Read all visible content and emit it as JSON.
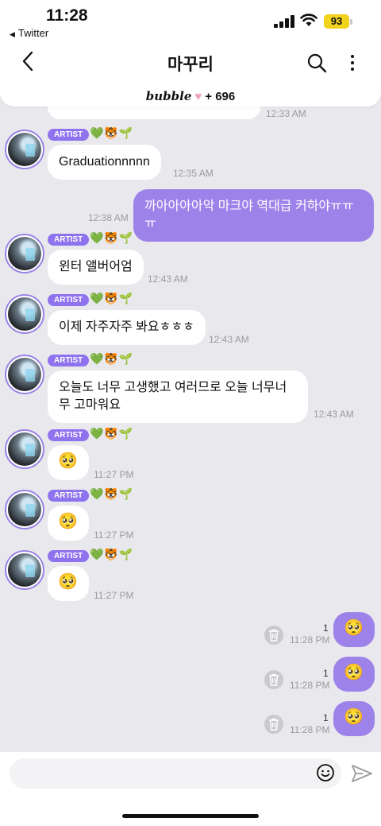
{
  "status_bar": {
    "time": "11:28",
    "back_app": "Twitter",
    "battery": "93"
  },
  "header": {
    "title": "마꾸리",
    "brand": "bubble",
    "count": "+ 696"
  },
  "artist_tag": "ARTIST",
  "emoji_icons": "💚🐯🌱",
  "messages": {
    "partial_time": "12:33 AM",
    "m1_text": "Graduationnnnn",
    "m1_time": "12:35 AM",
    "m2_text": "까아아아아악 마크야 역대급 커하야ㅠㅠㅠ",
    "m2_time": "12:38 AM",
    "m3_text": "윈터 앨버어엄",
    "m3_time": "12:43 AM",
    "m4_text": "이제 자주자주 봐요ㅎㅎㅎ",
    "m4_time": "12:43 AM",
    "m5_text": "오늘도 너무 고생했고 여러므로 오늘 너무너무 고마워요",
    "m5_time": "12:43 AM",
    "m6_text": "🥺",
    "m6_time": "11:27 PM",
    "m7_text": "🥺",
    "m7_time": "11:27 PM",
    "m8_text": "🥺",
    "m8_time": "11:27 PM",
    "o1_text": "🥺",
    "o1_count": "1",
    "o1_time": "11:28 PM",
    "o2_text": "🥺",
    "o2_count": "1",
    "o2_time": "11:28 PM",
    "o3_text": "🥺",
    "o3_count": "1",
    "o3_time": "11:28 PM"
  },
  "input": {
    "placeholder": ""
  },
  "colors": {
    "accent": "#9d82ea",
    "artist_tag": "#8e72ee",
    "background": "#e9e9ed"
  },
  "icons": [
    "back-icon",
    "search-icon",
    "more-icon",
    "heart-icon",
    "trash-icon",
    "smile-icon",
    "send-icon"
  ]
}
